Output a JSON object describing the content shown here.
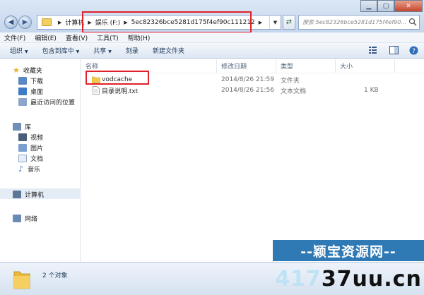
{
  "addressbar": {
    "crumbs": [
      "计算机",
      "娱乐 (F:)",
      "5ec82326bce5281d175f4ef90c111212"
    ]
  },
  "search": {
    "placeholder": "搜索 5ec82326bce5281d175f4ef90..."
  },
  "menubar": {
    "items": [
      "文件(F)",
      "编辑(E)",
      "查看(V)",
      "工具(T)",
      "帮助(H)"
    ]
  },
  "toolbar": {
    "organize": "组织",
    "include": "包含到库中",
    "share": "共享",
    "burn": "刻录",
    "new_folder": "新建文件夹"
  },
  "navpane": {
    "favorites": "收藏夹",
    "favorites_items": [
      "下载",
      "桌面",
      "最近访问的位置"
    ],
    "libraries": "库",
    "libraries_items": [
      "视频",
      "图片",
      "文档",
      "音乐"
    ],
    "computer": "计算机",
    "network": "网络"
  },
  "columns": {
    "name": "名称",
    "modified": "修改日期",
    "type": "类型",
    "size": "大小"
  },
  "files": [
    {
      "name": "vodcache",
      "modified": "2014/8/26 21:59",
      "type": "文件夹",
      "size": ""
    },
    {
      "name": "目录说明.txt",
      "modified": "2014/8/26 21:56",
      "type": "文本文档",
      "size": "1 KB"
    }
  ],
  "status": {
    "count": "2 个对象"
  },
  "watermark": {
    "line1": "--颖宝资源网--",
    "line2_a": "417",
    "line2_b": "37uu.cn"
  },
  "colors": {
    "highlight": "#e0202a",
    "accent": "#2f79b5"
  }
}
